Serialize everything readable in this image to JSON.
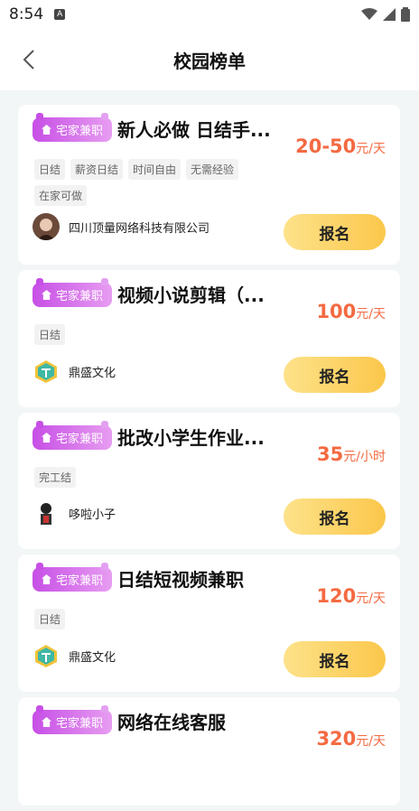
{
  "status_bar": {
    "time": "8:54",
    "notification_icon": "A"
  },
  "nav": {
    "title": "校园榜单"
  },
  "jobs": [
    {
      "badge": "宅家兼职",
      "title": "新人必做 日结手...",
      "salary_amount": "20-50",
      "salary_unit": "元/天",
      "tags": [
        "日结",
        "薪资日结",
        "时间自由",
        "无需经验",
        "在家可做"
      ],
      "company": "四川顶量网络科技有限公司",
      "apply_label": "报名"
    },
    {
      "badge": "宅家兼职",
      "title": "视频小说剪辑（...",
      "salary_amount": "100",
      "salary_unit": "元/天",
      "tags": [
        "日结"
      ],
      "company": "鼎盛文化",
      "apply_label": "报名"
    },
    {
      "badge": "宅家兼职",
      "title": "批改小学生作业...",
      "salary_amount": "35",
      "salary_unit": "元/小时",
      "tags": [
        "完工结"
      ],
      "company": "哆啦小子",
      "apply_label": "报名"
    },
    {
      "badge": "宅家兼职",
      "title": "日结短视频兼职",
      "salary_amount": "120",
      "salary_unit": "元/天",
      "tags": [
        "日结"
      ],
      "company": "鼎盛文化",
      "apply_label": "报名"
    },
    {
      "badge": "宅家兼职",
      "title": "网络在线客服",
      "salary_amount": "320",
      "salary_unit": "元/天",
      "tags": [],
      "company": "",
      "apply_label": ""
    }
  ]
}
